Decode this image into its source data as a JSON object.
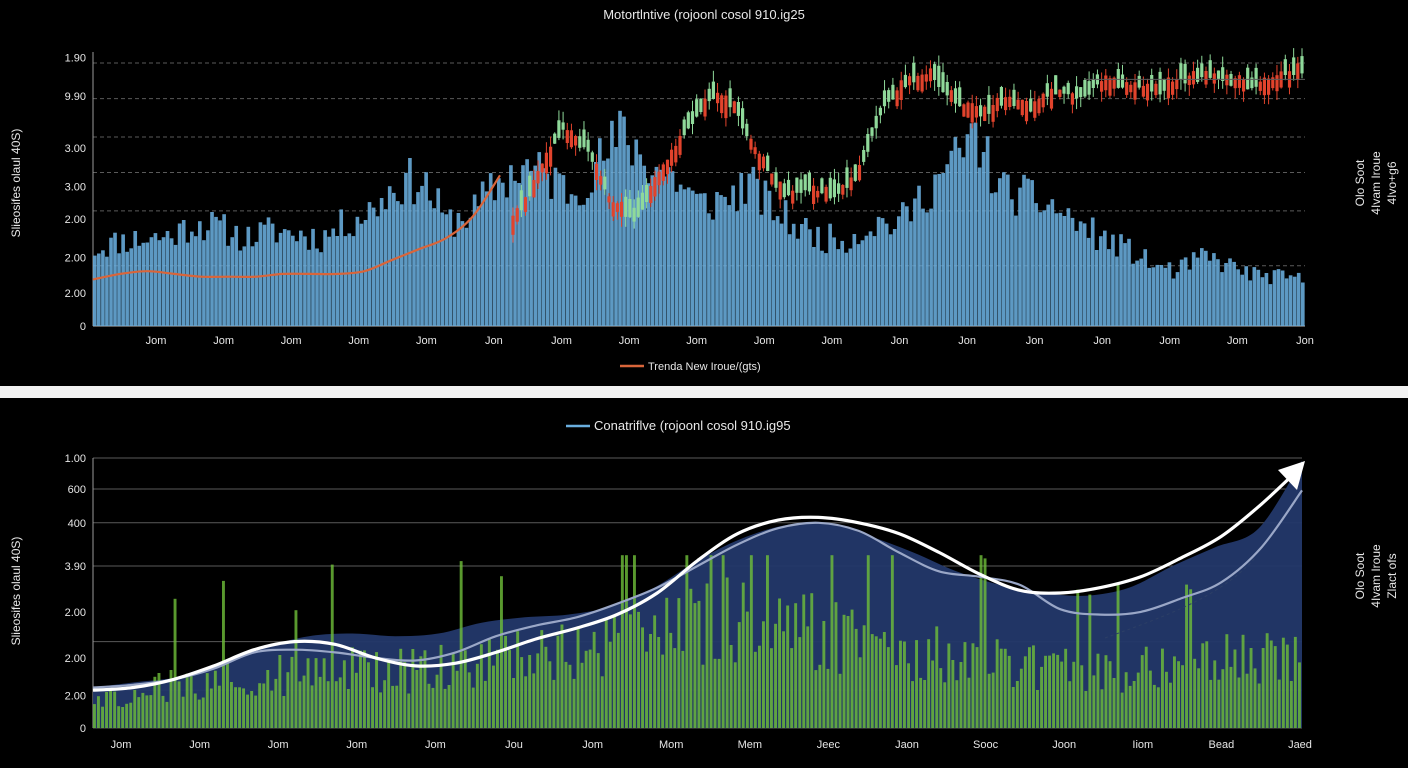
{
  "colors": {
    "volume_blue": "#6aaede",
    "bull_green": "#8fd99a",
    "bear_red": "#e1432c",
    "trend_orange": "#d9653a",
    "grid": "#5a5a5a",
    "area_navy": "#23386a",
    "volume_green": "#6fbf3a",
    "curve_white": "#ffffff",
    "curve_gray": "#9aa7c7"
  },
  "chart_data": [
    {
      "type": "bar",
      "title": "Motortlntive (rojoonl cosol 910.ig25",
      "ylabel": "Slieosifes olaul 40S)",
      "y_ticks": [
        "1.90",
        "9.90",
        "3.00",
        "3.00",
        "2.00",
        "2.00",
        "2.00",
        "0"
      ],
      "x_ticks": [
        "Jom",
        "Jom",
        "Jom",
        "Jom",
        "Jom",
        "Jon",
        "Jom",
        "Jom",
        "Jom",
        "Jom",
        "Jom",
        "Jon",
        "Jon",
        "Jon",
        "Jon",
        "Jom",
        "Jom",
        "Jon"
      ],
      "legend": [
        {
          "name": "Trenda New Iroue/(gts)",
          "color": "#d9653a"
        }
      ],
      "side_label": [
        "Olo Soot",
        "4Ivam Iroue",
        "4Ivo+g6"
      ],
      "series": [
        {
          "kind": "volume",
          "anchors": [
            0.3,
            0.33,
            0.34,
            0.35,
            0.4,
            0.38,
            0.34,
            0.37,
            0.36,
            0.34,
            0.4,
            0.45,
            0.55,
            0.57,
            0.4,
            0.44,
            0.55,
            0.62,
            0.58,
            0.52,
            0.63,
            0.75,
            0.63,
            0.58,
            0.47,
            0.49,
            0.55,
            0.45,
            0.38,
            0.34,
            0.34,
            0.4,
            0.4,
            0.52,
            0.62,
            0.74,
            0.53,
            0.5,
            0.47,
            0.4,
            0.34,
            0.3,
            0.24,
            0.21,
            0.27,
            0.24,
            0.2,
            0.19,
            0.18
          ],
          "gridlines_at": [
            0.22,
            0.42,
            0.56,
            0.69,
            0.83,
            0.96
          ]
        },
        {
          "kind": "candles",
          "anchors": [
            0.38,
            0.55,
            0.72,
            0.65,
            0.45,
            0.4,
            0.56,
            0.72,
            0.85,
            0.8,
            0.62,
            0.48,
            0.5,
            0.48,
            0.56,
            0.8,
            0.9,
            0.92,
            0.82,
            0.78,
            0.83,
            0.8,
            0.86,
            0.84,
            0.9,
            0.88,
            0.86,
            0.9,
            0.92,
            0.9,
            0.88,
            0.91,
            0.94
          ],
          "hline": 0.9
        },
        {
          "kind": "trend",
          "name": "Trenda New Iroue/(gts)",
          "anchors": [
            0.17,
            0.19,
            0.2,
            0.19,
            0.18,
            0.18,
            0.18,
            0.19,
            0.19,
            0.19,
            0.2,
            0.24,
            0.28,
            0.32,
            0.4,
            0.55
          ]
        }
      ]
    },
    {
      "type": "area",
      "title": "Conatriflve (rojoonl cosol 910.ig95",
      "ylabel": "Slieosifes olaul 40S)",
      "y_ticks": [
        "1.00",
        "600",
        "400",
        "3.90",
        "2.00",
        "2.00",
        "2.00",
        "0"
      ],
      "x_ticks": [
        "Jom",
        "Jom",
        "Jom",
        "Jom",
        "Jom",
        "Jou",
        "Jom",
        "Mom",
        "Mem",
        "Jeec",
        "Jaon",
        "Sooc",
        "Joon",
        "Iiom",
        "Bead",
        "Jaed"
      ],
      "legend": [
        {
          "name": "Conatriflve (rojoonl cosol 910.ig95",
          "color": "#6aaede"
        }
      ],
      "side_label": [
        "Olo Soot",
        "4Ivam Iroue",
        "Zlact ofs"
      ],
      "series": [
        {
          "kind": "area",
          "anchors": [
            0.15,
            0.17,
            0.19,
            0.24,
            0.3,
            0.34,
            0.35,
            0.34,
            0.35,
            0.39,
            0.41,
            0.42,
            0.45,
            0.52,
            0.62,
            0.7,
            0.75,
            0.76,
            0.71,
            0.65,
            0.58,
            0.53,
            0.5,
            0.49,
            0.52,
            0.6,
            0.67,
            0.74,
            0.99
          ]
        },
        {
          "kind": "volume",
          "anchors": [
            0.1,
            0.14,
            0.18,
            0.2,
            0.22,
            0.2,
            0.24,
            0.22,
            0.24,
            0.26,
            0.28,
            0.3,
            0.32,
            0.36,
            0.4,
            0.44,
            0.42,
            0.4,
            0.36,
            0.32,
            0.3,
            0.28,
            0.26,
            0.24,
            0.22,
            0.24,
            0.26,
            0.28,
            0.3,
            0.28
          ]
        },
        {
          "kind": "white_curve",
          "anchors": [
            0.14,
            0.15,
            0.18,
            0.23,
            0.29,
            0.32,
            0.31,
            0.26,
            0.23,
            0.24,
            0.28,
            0.33,
            0.37,
            0.42,
            0.5,
            0.62,
            0.72,
            0.77,
            0.78,
            0.76,
            0.72,
            0.65,
            0.57,
            0.51,
            0.5,
            0.52,
            0.56,
            0.63,
            0.71,
            0.83,
            0.97
          ]
        },
        {
          "kind": "gray_curve",
          "anchors": [
            0.15,
            0.16,
            0.18,
            0.22,
            0.28,
            0.29,
            0.28,
            0.26,
            0.25,
            0.28,
            0.34,
            0.38,
            0.41,
            0.46,
            0.52,
            0.6,
            0.68,
            0.74,
            0.76,
            0.73,
            0.65,
            0.58,
            0.56,
            0.53,
            0.44,
            0.42,
            0.43,
            0.48,
            0.54,
            0.67,
            0.88
          ]
        }
      ]
    }
  ]
}
